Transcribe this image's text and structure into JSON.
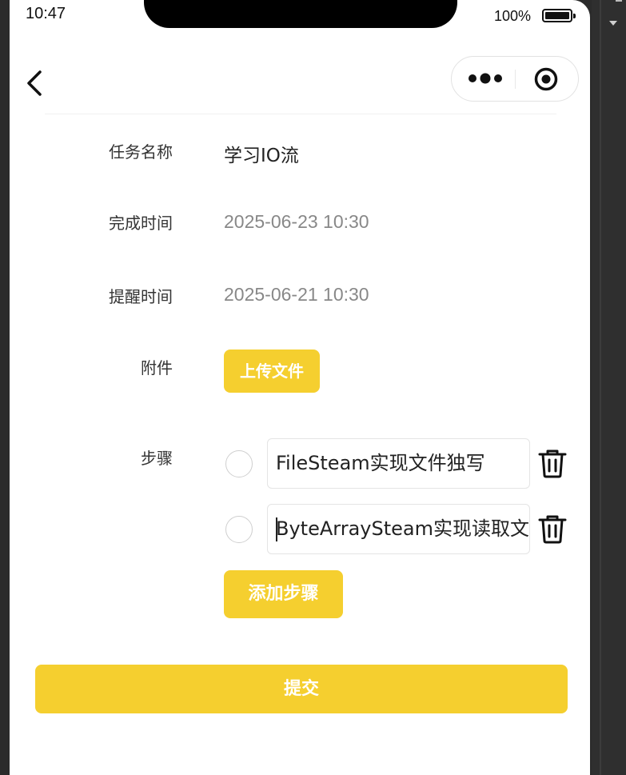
{
  "status_bar": {
    "time": "10:47",
    "battery": "100%"
  },
  "nav": {
    "back_icon": "chevron-left-icon",
    "more_icon": "more-dots-icon",
    "target_icon": "record-target-icon"
  },
  "form": {
    "task_name_label": "任务名称",
    "task_name_value": "学习IO流",
    "due_label": "完成时间",
    "due_value": "2025-06-23 10:30",
    "remind_label": "提醒时间",
    "remind_value": "2025-06-21 10:30",
    "attachment_label": "附件",
    "upload_button": "上传文件",
    "steps_label": "步骤",
    "steps": [
      {
        "text": "FileSteam实现文件独写"
      },
      {
        "text": "ByteArraySteam实现读取文件"
      }
    ],
    "add_step_button": "添加步骤",
    "submit_button": "提交"
  },
  "colors": {
    "accent": "#f5cf2f",
    "date_text": "#888888"
  }
}
